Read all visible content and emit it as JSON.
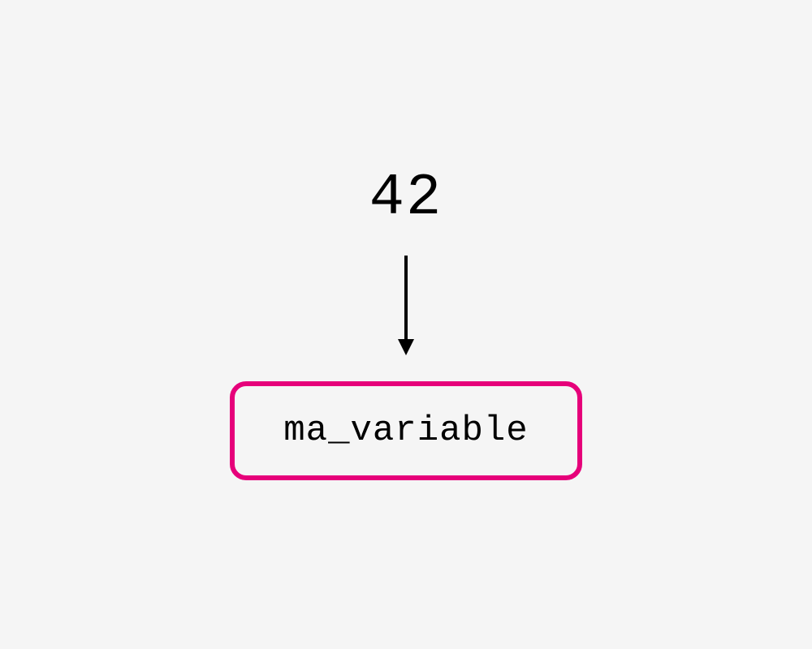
{
  "diagram": {
    "value": "42",
    "variable_name": "ma_variable",
    "box_border_color": "#e6007a"
  }
}
